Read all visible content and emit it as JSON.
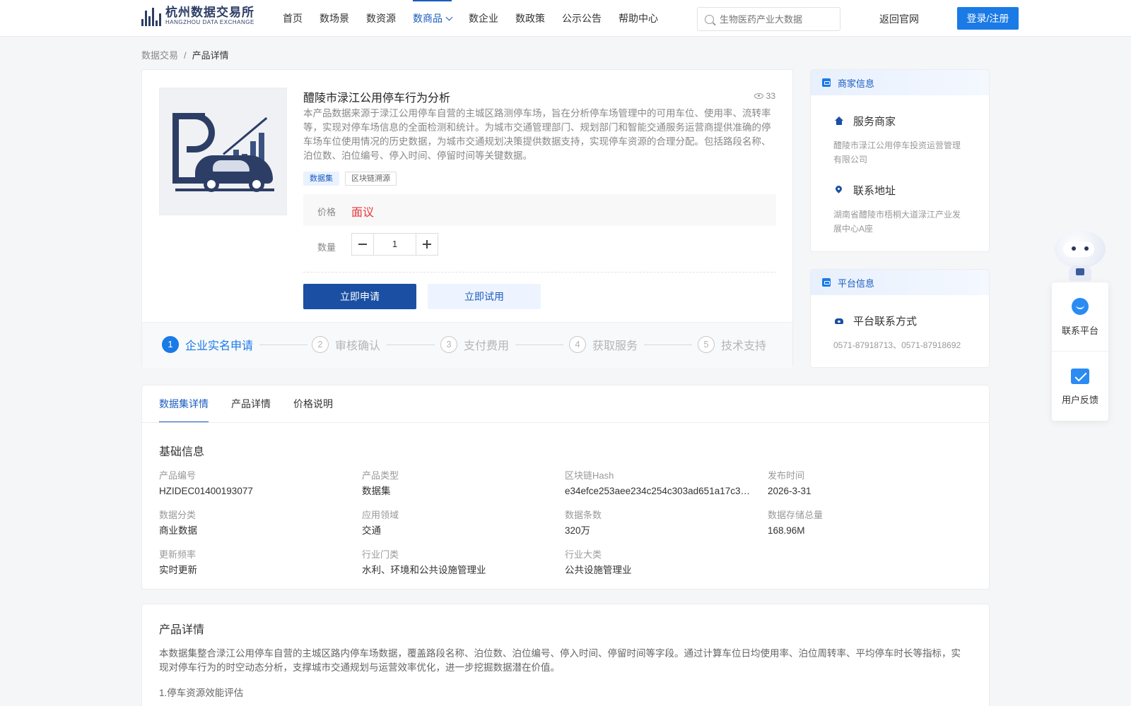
{
  "header": {
    "logo_cn": "杭州数据交易所",
    "logo_en": "HANGZHOU DATA EXCHANGE",
    "nav": [
      {
        "label": "首页"
      },
      {
        "label": "数场景"
      },
      {
        "label": "数资源"
      },
      {
        "label": "数商品",
        "active": true
      },
      {
        "label": "数企业"
      },
      {
        "label": "数政策"
      },
      {
        "label": "公示公告"
      },
      {
        "label": "帮助中心"
      }
    ],
    "search_placeholder": "生物医药产业大数据",
    "back_label": "返回官网",
    "login_label": "登录/注册",
    "accent_color": "#1a7ae6"
  },
  "breadcrumb": {
    "root": "数据交易",
    "sep": "/",
    "current": "产品详情"
  },
  "product": {
    "title": "醴陵市渌江公用停车行为分析",
    "views": "33",
    "description": "本产品数据来源于渌江公用停车自营的主城区路测停车场，旨在分析停车场管理中的可用车位、使用率、流转率等，实现对停车场信息的全面检测和统计。为城市交通管理部门、规划部门和智能交通服务运营商提供准确的停车场车位使用情况的历史数据，为城市交通规划决策提供数据支持，实现停车资源的合理分配。包括路段名称、泊位数、泊位编号、停入时间、停留时间等关键数据。",
    "tags": [
      "数据集",
      "区块链溯源"
    ],
    "price_label": "价格",
    "price_value": "面议",
    "qty_label": "数量",
    "qty_value": "1",
    "apply_label": "立即申请",
    "trial_label": "立即试用",
    "price_color": "#e5383b"
  },
  "steps": [
    {
      "num": "1",
      "label": "企业实名申请",
      "active": true
    },
    {
      "num": "2",
      "label": "审核确认"
    },
    {
      "num": "3",
      "label": "支付费用"
    },
    {
      "num": "4",
      "label": "获取服务"
    },
    {
      "num": "5",
      "label": "技术支持"
    }
  ],
  "merchant": {
    "head": "商家信息",
    "service_title": "服务商家",
    "service_value": "醴陵市渌江公用停车投资运营管理有限公司",
    "address_title": "联系地址",
    "address_value": "湖南省醴陵市梧桐大道渌江产业发展中心A座"
  },
  "platform": {
    "head": "平台信息",
    "contact_title": "平台联系方式",
    "contact_value": "0571-87918713、0571-87918692"
  },
  "tabs": [
    {
      "label": "数据集详情",
      "active": true
    },
    {
      "label": "产品详情"
    },
    {
      "label": "价格说明"
    }
  ],
  "basic_info": {
    "title": "基础信息",
    "items": [
      {
        "label": "产品编号",
        "value": "HZIDEC01400193077"
      },
      {
        "label": "产品类型",
        "value": "数据集"
      },
      {
        "label": "区块链Hash",
        "value": "e34efce253aee234c254c303ad651a17c3…"
      },
      {
        "label": "发布时间",
        "value": "2026-3-31"
      },
      {
        "label": "数据分类",
        "value": "商业数据"
      },
      {
        "label": "应用领域",
        "value": "交通"
      },
      {
        "label": "数据条数",
        "value": "320万"
      },
      {
        "label": "数据存储总量",
        "value": "168.96M"
      },
      {
        "label": "更新频率",
        "value": "实时更新"
      },
      {
        "label": "行业门类",
        "value": "水利、环境和公共设施管理业"
      },
      {
        "label": "行业大类",
        "value": "公共设施管理业"
      }
    ]
  },
  "product_detail": {
    "title": "产品详情",
    "text": "本数据集整合渌江公用停车自营的主城区路内停车场数据，覆盖路段名称、泊位数、泊位编号、停入时间、停留时间等字段。通过计算车位日均使用率、泊位周转率、平均停车时长等指标，实现对停车行为的时空动态分析，支撑城市交通规划与运营效率优化，进一步挖掘数据潜在价值。",
    "point1": "1.停车资源效能评估"
  },
  "float": {
    "contact_label": "联系平台",
    "feedback_label": "用户反馈"
  }
}
